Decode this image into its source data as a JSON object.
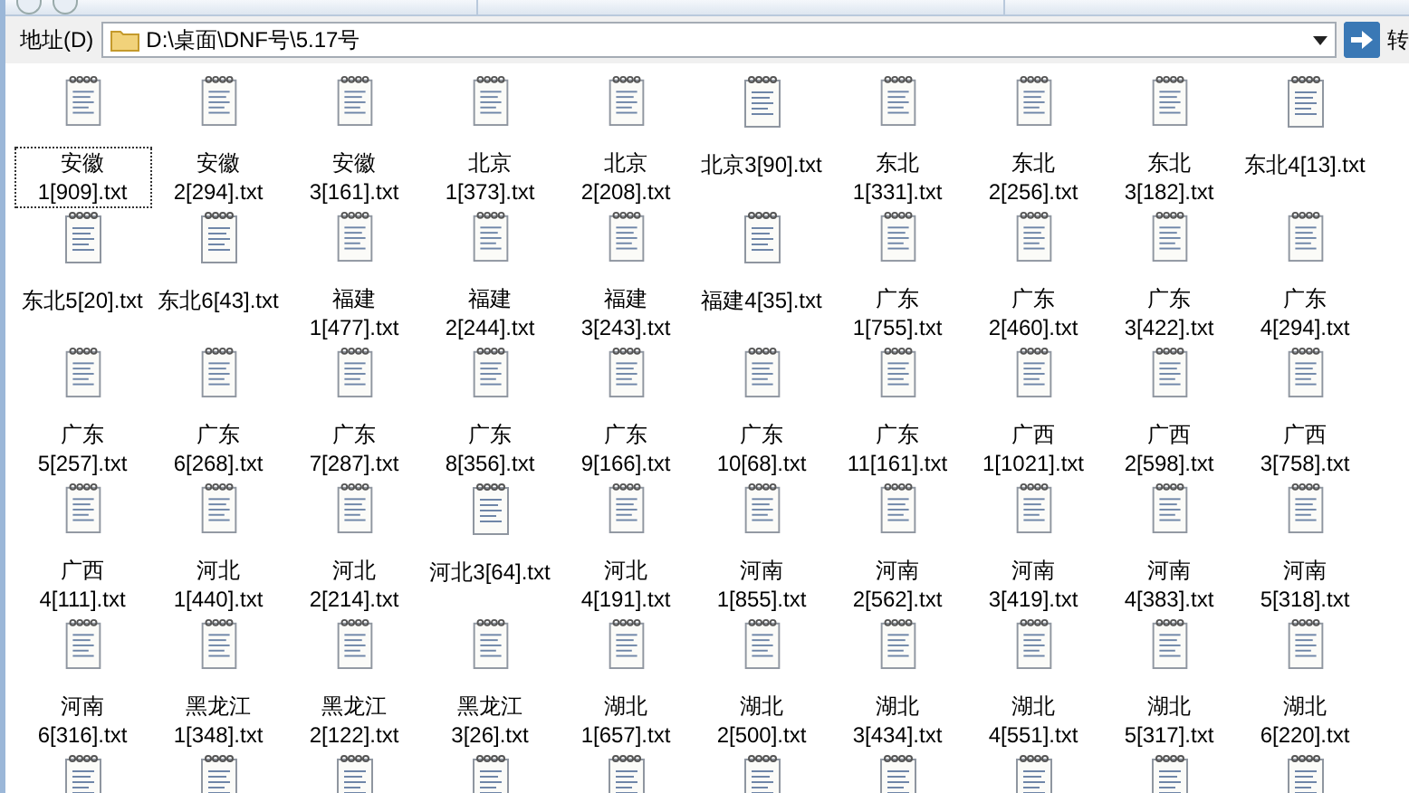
{
  "address_bar": {
    "label": "地址(D)",
    "path": "D:\\桌面\\DNF号\\5.17号",
    "go_label": "转"
  },
  "files": [
    {
      "name": "安徽 1[909].txt",
      "selected": true
    },
    {
      "name": "安徽 2[294].txt",
      "selected": false
    },
    {
      "name": "安徽 3[161].txt",
      "selected": false
    },
    {
      "name": "北京 1[373].txt",
      "selected": false
    },
    {
      "name": "北京 2[208].txt",
      "selected": false
    },
    {
      "name": "北京3[90].txt",
      "selected": false
    },
    {
      "name": "东北 1[331].txt",
      "selected": false
    },
    {
      "name": "东北 2[256].txt",
      "selected": false
    },
    {
      "name": "东北 3[182].txt",
      "selected": false
    },
    {
      "name": "东北4[13].txt",
      "selected": false
    },
    {
      "name": "东北5[20].txt",
      "selected": false
    },
    {
      "name": "东北6[43].txt",
      "selected": false
    },
    {
      "name": "福建 1[477].txt",
      "selected": false
    },
    {
      "name": "福建 2[244].txt",
      "selected": false
    },
    {
      "name": "福建 3[243].txt",
      "selected": false
    },
    {
      "name": "福建4[35].txt",
      "selected": false
    },
    {
      "name": "广东 1[755].txt",
      "selected": false
    },
    {
      "name": "广东 2[460].txt",
      "selected": false
    },
    {
      "name": "广东 3[422].txt",
      "selected": false
    },
    {
      "name": "广东 4[294].txt",
      "selected": false
    },
    {
      "name": "广东 5[257].txt",
      "selected": false
    },
    {
      "name": "广东 6[268].txt",
      "selected": false
    },
    {
      "name": "广东 7[287].txt",
      "selected": false
    },
    {
      "name": "广东 8[356].txt",
      "selected": false
    },
    {
      "name": "广东 9[166].txt",
      "selected": false
    },
    {
      "name": "广东 10[68].txt",
      "selected": false
    },
    {
      "name": "广东 11[161].txt",
      "selected": false
    },
    {
      "name": "广西 1[1021].txt",
      "selected": false
    },
    {
      "name": "广西 2[598].txt",
      "selected": false
    },
    {
      "name": "广西 3[758].txt",
      "selected": false
    },
    {
      "name": "广西 4[111].txt",
      "selected": false
    },
    {
      "name": "河北 1[440].txt",
      "selected": false
    },
    {
      "name": "河北 2[214].txt",
      "selected": false
    },
    {
      "name": "河北3[64].txt",
      "selected": false
    },
    {
      "name": "河北 4[191].txt",
      "selected": false
    },
    {
      "name": "河南 1[855].txt",
      "selected": false
    },
    {
      "name": "河南 2[562].txt",
      "selected": false
    },
    {
      "name": "河南 3[419].txt",
      "selected": false
    },
    {
      "name": "河南 4[383].txt",
      "selected": false
    },
    {
      "name": "河南 5[318].txt",
      "selected": false
    },
    {
      "name": "河南 6[316].txt",
      "selected": false
    },
    {
      "name": "黑龙江 1[348].txt",
      "selected": false
    },
    {
      "name": "黑龙江 2[122].txt",
      "selected": false
    },
    {
      "name": "黑龙江 3[26].txt",
      "selected": false
    },
    {
      "name": "湖北 1[657].txt",
      "selected": false
    },
    {
      "name": "湖北 2[500].txt",
      "selected": false
    },
    {
      "name": "湖北 3[434].txt",
      "selected": false
    },
    {
      "name": "湖北 4[551].txt",
      "selected": false
    },
    {
      "name": "湖北 5[317].txt",
      "selected": false
    },
    {
      "name": "湖北 6[220].txt",
      "selected": false
    }
  ],
  "more_files_below": true
}
